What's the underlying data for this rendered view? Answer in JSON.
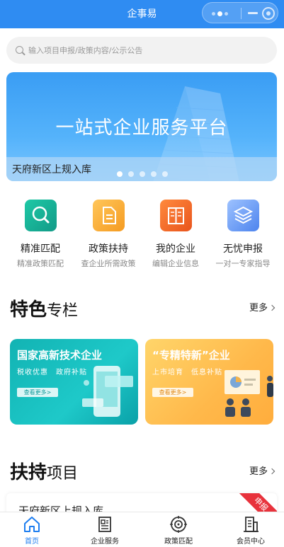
{
  "navbar": {
    "title": "企事易"
  },
  "search": {
    "placeholder": "输入项目申报/政策内容/公示公告"
  },
  "banner": {
    "headline": "一站式企业服务平台",
    "caption": "天府新区上规入库",
    "slide_count": 5,
    "active_slide": 1
  },
  "quick_menu": [
    {
      "label": "精准匹配",
      "sub": "精准政策匹配",
      "icon": "search-icon",
      "color": "#17b39a"
    },
    {
      "label": "政策扶持",
      "sub": "查企业所需政策",
      "icon": "document-icon",
      "color": "#f8ac33"
    },
    {
      "label": "我的企业",
      "sub": "编辑企业信息",
      "icon": "book-icon",
      "color": "#f06a28"
    },
    {
      "label": "无忧申报",
      "sub": "一对一专家指导",
      "icon": "layers-icon",
      "color": "#6f9cf5"
    }
  ],
  "featured": {
    "title_bold": "特色",
    "title_rest": "专栏",
    "more": "更多",
    "cards": [
      {
        "title": "国家高新技术企业",
        "subtitle": "税收优惠　政府补贴",
        "button": "查看更多>"
      },
      {
        "title": "“专精特新”企业",
        "subtitle": "上市培育　低息补贴",
        "button": "查看更多>"
      }
    ]
  },
  "projects": {
    "title_bold": "扶持",
    "title_rest": "项目",
    "more": "更多",
    "first_item": {
      "title": "天府新区上规入库",
      "ribbon": "申报"
    }
  },
  "tabbar": [
    {
      "label": "首页",
      "icon": "home-icon",
      "active": true
    },
    {
      "label": "企业服务",
      "icon": "newspaper-icon",
      "active": false
    },
    {
      "label": "政策匹配",
      "icon": "target-icon",
      "active": false
    },
    {
      "label": "会员中心",
      "icon": "building-icon",
      "active": false
    }
  ],
  "colors": {
    "primary": "#2f8cf2",
    "active_tab": "#1e7ef0",
    "ribbon": "#e8323c"
  }
}
